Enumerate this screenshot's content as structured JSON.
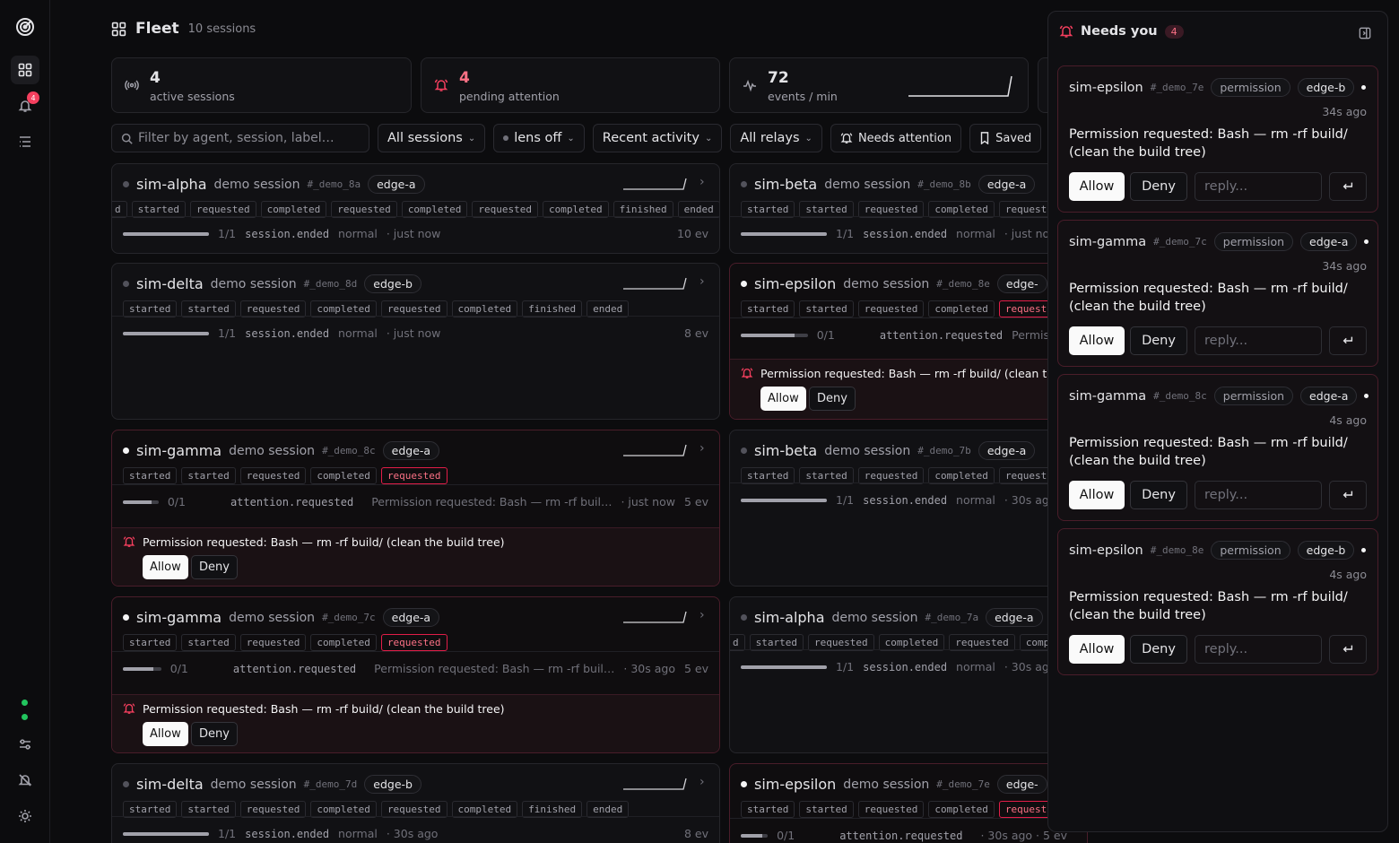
{
  "header": {
    "title": "Fleet",
    "subtitle": "10 sessions"
  },
  "rail": {
    "notifications_badge": "4"
  },
  "stats": [
    {
      "value": "4",
      "label": "active sessions"
    },
    {
      "value": "4",
      "label": "pending attention"
    },
    {
      "value": "72",
      "label": "events / min"
    }
  ],
  "toolbar": {
    "search_placeholder": "Filter by agent, session, label…",
    "sessions": "All sessions",
    "lens": "lens off",
    "sort": "Recent activity",
    "relays": "All relays",
    "needs": "Needs attention",
    "saved": "Saved"
  },
  "perm_text": "Permission requested: Bash — rm -rf build/ (clean the build tree)",
  "perm_text_short": "Permission requested: Bash — rm -rf buil…",
  "perm_text_clip": "Permission requested: Bash — rm -rf build/ (clean the",
  "allow": "Allow",
  "deny": "Deny",
  "cards": [
    {
      "name": "sim-alpha",
      "desc": "demo session",
      "id": "#_demo_8a",
      "relay": "edge-a",
      "tags": [
        "d",
        "started",
        "requested",
        "completed",
        "requested",
        "completed",
        "requested",
        "completed",
        "finished",
        "ended"
      ],
      "progress": "1/1",
      "event": "session.ended",
      "level": "normal",
      "time": "· just now",
      "ev": "10 ev"
    },
    {
      "name": "sim-beta",
      "desc": "demo session",
      "id": "#_demo_8b",
      "relay": "edge-a",
      "tags": [
        "started",
        "started",
        "requested",
        "completed",
        "requeste"
      ],
      "progress": "1/1",
      "event": "session.ended",
      "level": "normal",
      "time": "· just now",
      "ev": ""
    },
    {
      "name": "sim-delta",
      "desc": "demo session",
      "id": "#_demo_8d",
      "relay": "edge-b",
      "tags": [
        "started",
        "started",
        "requested",
        "completed",
        "requested",
        "completed",
        "finished",
        "ended"
      ],
      "progress": "1/1",
      "event": "session.ended",
      "level": "normal",
      "time": "· just now",
      "ev": "8 ev"
    },
    {
      "name": "sim-epsilon",
      "desc": "demo session",
      "id": "#_demo_8e",
      "relay": "edge-",
      "tags": [
        "started",
        "started",
        "requested",
        "completed",
        "requeste"
      ],
      "progress": "0/1",
      "event": "attention.requested",
      "level": "Permissi",
      "time": "",
      "ev": ""
    },
    {
      "name": "sim-gamma",
      "desc": "demo session",
      "id": "#_demo_8c",
      "relay": "edge-a",
      "tags": [
        "started",
        "started",
        "requested",
        "completed",
        "requested"
      ],
      "progress": "0/1",
      "event": "attention.requested",
      "level": "",
      "time": "· just now",
      "ev": "5 ev"
    },
    {
      "name": "sim-beta",
      "desc": "demo session",
      "id": "#_demo_7b",
      "relay": "edge-a",
      "tags": [
        "started",
        "started",
        "requested",
        "completed",
        "requeste"
      ],
      "progress": "1/1",
      "event": "session.ended",
      "level": "normal",
      "time": "· 30s ago",
      "ev": ""
    },
    {
      "name": "sim-gamma",
      "desc": "demo session",
      "id": "#_demo_7c",
      "relay": "edge-a",
      "tags": [
        "started",
        "started",
        "requested",
        "completed",
        "requested"
      ],
      "progress": "0/1",
      "event": "attention.requested",
      "level": "",
      "time": "· 30s ago",
      "ev": "5 ev"
    },
    {
      "name": "sim-alpha",
      "desc": "demo session",
      "id": "#_demo_7a",
      "relay": "edge-a",
      "tags": [
        "d",
        "started",
        "requested",
        "completed",
        "requested",
        "compl"
      ],
      "progress": "1/1",
      "event": "session.ended",
      "level": "normal",
      "time": "· 30s ago",
      "ev": ""
    },
    {
      "name": "sim-delta",
      "desc": "demo session",
      "id": "#_demo_7d",
      "relay": "edge-b",
      "tags": [
        "started",
        "started",
        "requested",
        "completed",
        "requested",
        "completed",
        "finished",
        "ended"
      ],
      "progress": "1/1",
      "event": "session.ended",
      "level": "normal",
      "time": "· 30s ago",
      "ev": "8 ev"
    },
    {
      "name": "sim-epsilon",
      "desc": "demo session",
      "id": "#_demo_7e",
      "relay": "edge-",
      "tags": [
        "started",
        "started",
        "requested",
        "completed",
        "requeste"
      ],
      "progress": "0/1",
      "event": "attention.requested",
      "level": "",
      "time": "· 30s ago · 5 ev",
      "ev": ""
    }
  ],
  "panel": {
    "title": "Needs you",
    "count": "4",
    "reply_placeholder": "reply...",
    "items": [
      {
        "name": "sim-epsilon",
        "id": "#_demo_7e",
        "kind": "permission",
        "relay": "edge-b",
        "ago": "34s ago"
      },
      {
        "name": "sim-gamma",
        "id": "#_demo_7c",
        "kind": "permission",
        "relay": "edge-a",
        "ago": "34s ago"
      },
      {
        "name": "sim-gamma",
        "id": "#_demo_8c",
        "kind": "permission",
        "relay": "edge-a",
        "ago": "4s ago"
      },
      {
        "name": "sim-epsilon",
        "id": "#_demo_8e",
        "kind": "permission",
        "relay": "edge-b",
        "ago": "4s ago"
      }
    ]
  }
}
